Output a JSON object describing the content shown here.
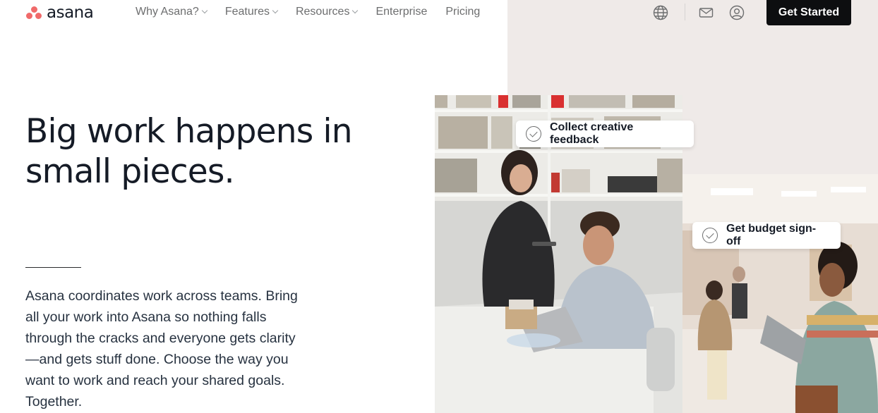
{
  "brand": {
    "name": "asana",
    "logo_color": "#f06a6a"
  },
  "nav": {
    "items": [
      {
        "label": "Why Asana?",
        "has_dropdown": true
      },
      {
        "label": "Features",
        "has_dropdown": true
      },
      {
        "label": "Resources",
        "has_dropdown": true
      },
      {
        "label": "Enterprise",
        "has_dropdown": false
      },
      {
        "label": "Pricing",
        "has_dropdown": false
      }
    ],
    "icons": [
      "globe-icon",
      "mail-icon",
      "account-icon"
    ],
    "cta_label": "Get Started"
  },
  "hero": {
    "headline": "Big work happens in small pieces.",
    "body": "Asana coordinates work across teams. Bring all your work into Asana so nothing falls through the cracks and everyone gets clarity—and gets stuff done. Choose the way you want to work and reach your shared goals. Together."
  },
  "tags": [
    {
      "label": "Collect creative feedback"
    },
    {
      "label": "Get budget sign-off"
    }
  ],
  "colors": {
    "cta_bg": "#0d0e10",
    "panel_bg": "#efeae8",
    "text": "#151b26"
  }
}
